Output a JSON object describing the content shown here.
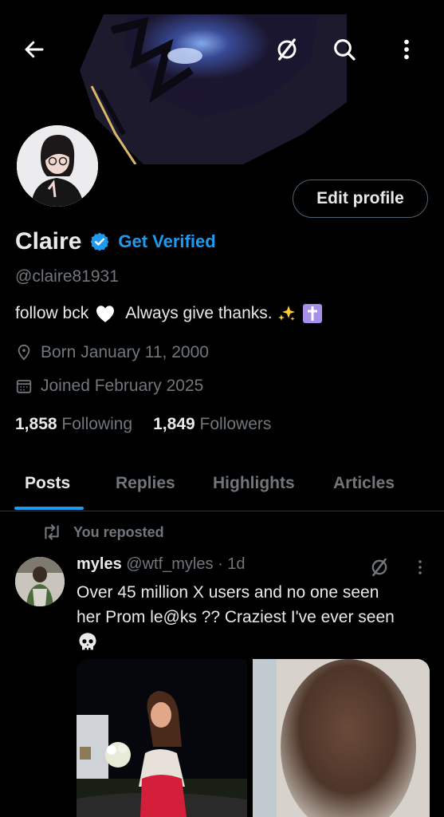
{
  "header": {
    "back_icon": "arrow-left-icon",
    "grok_icon": "grok-slash-icon",
    "search_icon": "search-icon",
    "more_icon": "more-vertical-icon"
  },
  "profile": {
    "name": "Claire",
    "handle": "@claire81931",
    "get_verified_label": "Get Verified",
    "edit_profile_label": "Edit profile",
    "bio_part1": "follow bck",
    "bio_part2": "Always give thanks.",
    "born": "Born January 11, 2000",
    "joined": "Joined February 2025",
    "following_count": "1,858",
    "following_label": "Following",
    "followers_count": "1,849",
    "followers_label": "Followers"
  },
  "tabs": [
    {
      "label": "Posts",
      "active": true
    },
    {
      "label": "Replies",
      "active": false
    },
    {
      "label": "Highlights",
      "active": false
    },
    {
      "label": "Articles",
      "active": false
    }
  ],
  "post": {
    "repost_label": "You reposted",
    "author": "myles",
    "handle": "@wtf_myles",
    "time": "· 1d",
    "text_line1": "Over 45 million X users and no one seen",
    "text_line2": "her Prom le@ks ?? Craziest I've ever seen"
  },
  "colors": {
    "background": "#000000",
    "accent": "#1d9bf0",
    "text_primary": "#e7e9ea",
    "text_secondary": "#71767b"
  }
}
